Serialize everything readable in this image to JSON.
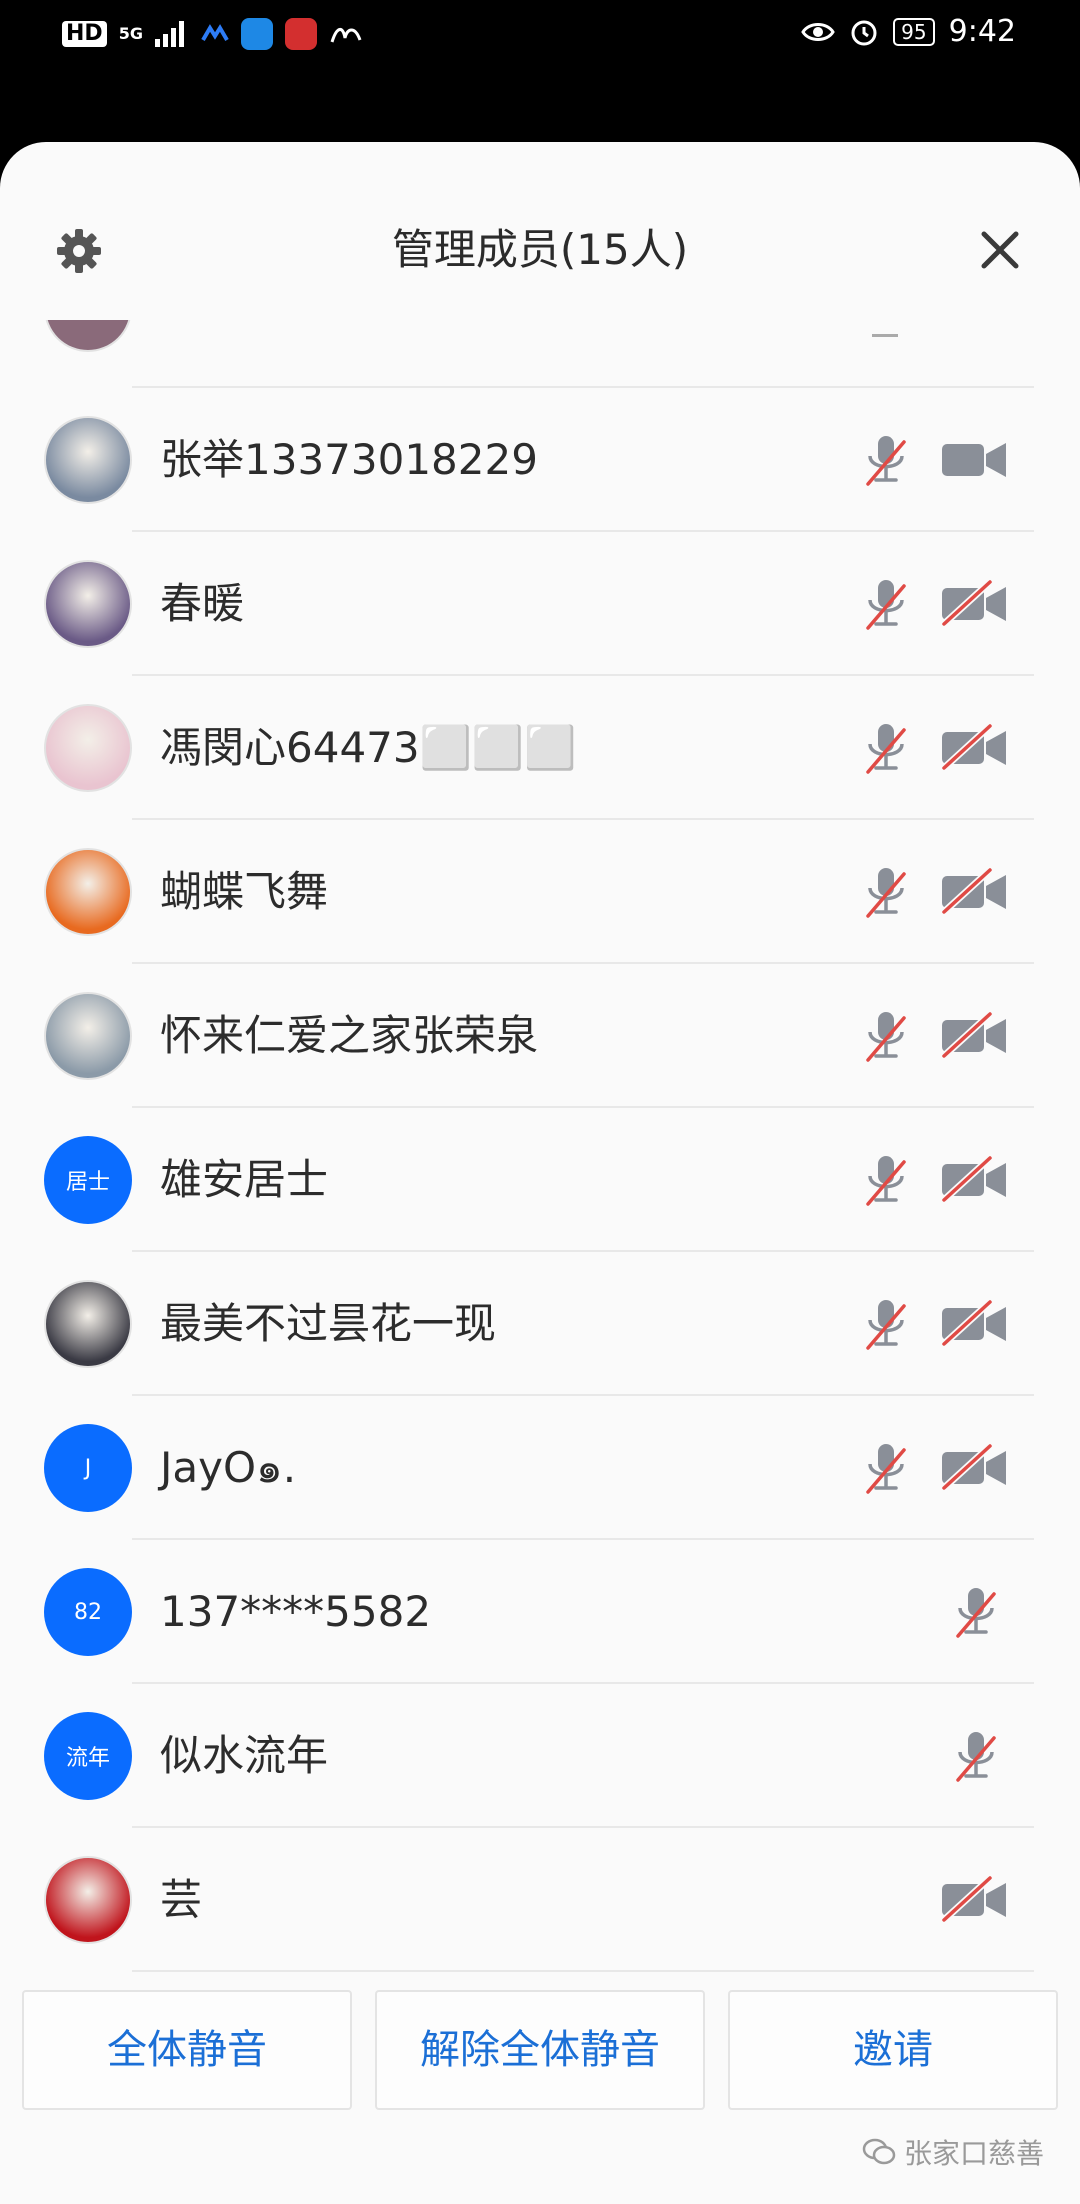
{
  "status_bar": {
    "hd": "HD",
    "network": "5G",
    "battery": "95",
    "time": "9:42"
  },
  "header": {
    "title": "管理成员(15人)"
  },
  "members": [
    {
      "name": "张举13373018229",
      "avatar": "photo",
      "photo_color": "#7a8aa0",
      "mic_muted": true,
      "camera": "on"
    },
    {
      "name": "春暖",
      "avatar": "photo",
      "photo_color": "#6a5a86",
      "mic_muted": true,
      "camera": "off"
    },
    {
      "name": "馮閔心64473⬜⬜⬜",
      "avatar": "photo",
      "photo_color": "#e9c4d0",
      "mic_muted": true,
      "camera": "off"
    },
    {
      "name": "蝴蝶飞舞",
      "avatar": "photo",
      "photo_color": "#e86a20",
      "mic_muted": true,
      "camera": "off"
    },
    {
      "name": "怀来仁爱之家张荣泉",
      "avatar": "photo",
      "photo_color": "#8b9aa8",
      "mic_muted": true,
      "camera": "off"
    },
    {
      "name": "雄安居士",
      "avatar": "text",
      "avatar_text": "居士",
      "mic_muted": true,
      "camera": "off"
    },
    {
      "name": "最美不过昙花一现",
      "avatar": "photo",
      "photo_color": "#3a3a44",
      "mic_muted": true,
      "camera": "off"
    },
    {
      "name": "JayO๑.",
      "avatar": "text",
      "avatar_text": "J",
      "mic_muted": true,
      "camera": "off"
    },
    {
      "name": "137****5582",
      "avatar": "text",
      "avatar_text": "82",
      "mic_muted": true,
      "camera": "none"
    },
    {
      "name": "似水流年",
      "avatar": "text",
      "avatar_text": "流年",
      "mic_muted": true,
      "camera": "none"
    },
    {
      "name": "芸",
      "avatar": "photo",
      "photo_color": "#c0141c",
      "mic_muted": null,
      "camera": "off"
    }
  ],
  "actions": {
    "mute_all": "全体静音",
    "unmute_all": "解除全体静音",
    "invite": "邀请"
  },
  "watermark": "张家口慈善",
  "colors": {
    "accent_blue": "#0a6cff",
    "action_text": "#1b6fd6",
    "icon_gray": "#8a8f98",
    "slash_red": "#e04a45"
  }
}
